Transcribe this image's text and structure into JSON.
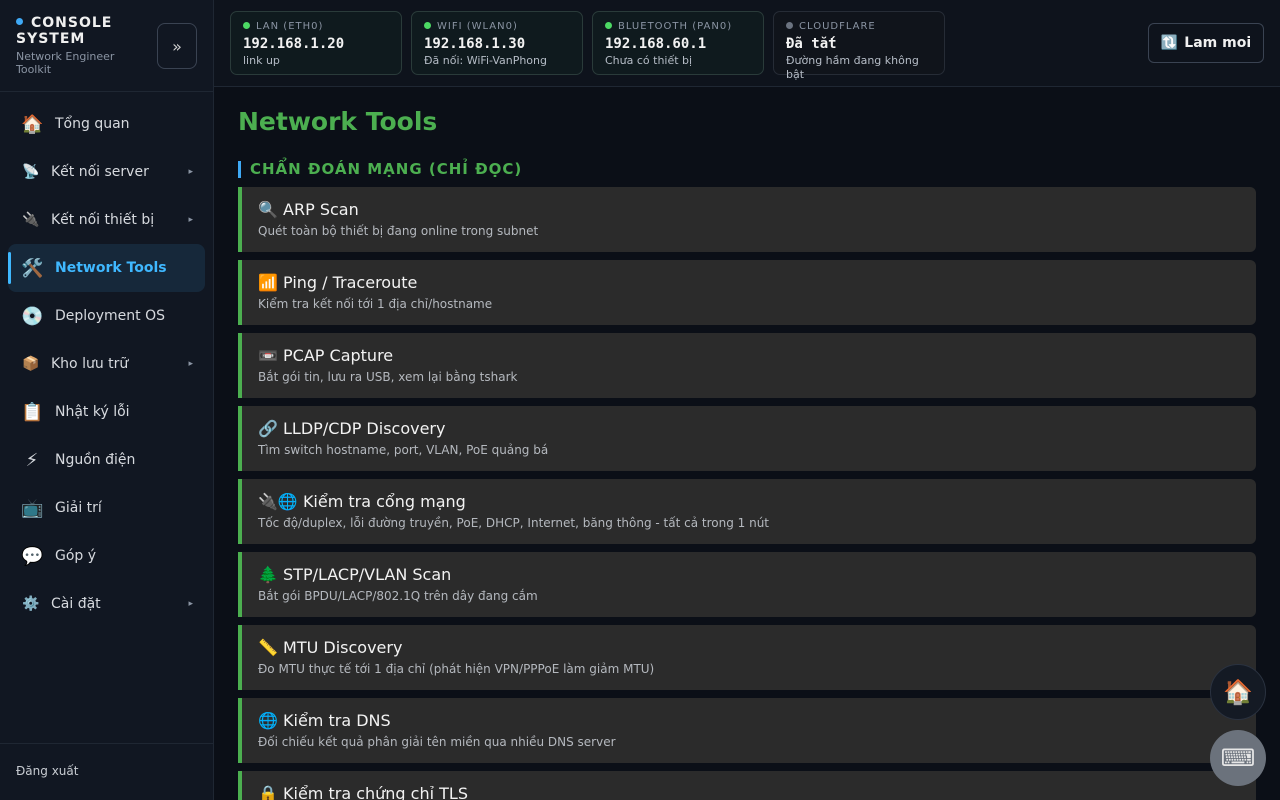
{
  "brand": {
    "title": "CONSOLE SYSTEM",
    "subtitle": "Network Engineer Toolkit",
    "collapse_label": "»"
  },
  "sidebar": {
    "items": [
      {
        "icon": "🏠",
        "label": "Tổng quan",
        "has_submenu": false
      },
      {
        "icon": "📡",
        "label": "Kết nối server",
        "has_submenu": true
      },
      {
        "icon": "🔌",
        "label": "Kết nối thiết bị",
        "has_submenu": true
      },
      {
        "icon": "🛠️",
        "label": "Network Tools",
        "has_submenu": false,
        "active": true
      },
      {
        "icon": "💿",
        "label": "Deployment OS",
        "has_submenu": false
      },
      {
        "icon": "📦",
        "label": "Kho lưu trữ",
        "has_submenu": true
      },
      {
        "icon": "📋",
        "label": "Nhật ký lỗi",
        "has_submenu": false
      },
      {
        "icon": "⚡",
        "label": "Nguồn điện",
        "has_submenu": false
      },
      {
        "icon": "📺",
        "label": "Giải trí",
        "has_submenu": false
      },
      {
        "icon": "💬",
        "label": "Góp ý",
        "has_submenu": false
      },
      {
        "icon": "⚙️",
        "label": "Cài đặt",
        "has_submenu": true
      }
    ],
    "chevron": "▸",
    "logout_label": "Đăng xuất"
  },
  "status_cards": [
    {
      "label": "LAN (ETH0)",
      "value": "192.168.1.20",
      "sub": "link up",
      "status": "up"
    },
    {
      "label": "WIFI (WLAN0)",
      "value": "192.168.1.30",
      "sub": "Đã nối: WiFi-VanPhong",
      "status": "up"
    },
    {
      "label": "BLUETOOTH (PAN0)",
      "value": "192.168.60.1",
      "sub": "Chưa có thiết bị",
      "status": "up"
    },
    {
      "label": "CLOUDFLARE",
      "value": "Đã tắt",
      "sub": "Đường hầm đang không bật",
      "status": "off"
    }
  ],
  "refresh": {
    "icon": "🔃",
    "label": "Lam moi"
  },
  "main": {
    "title": "Network Tools",
    "section_title": "CHẨN ĐOÁN MẠNG (CHỈ ĐỌC)",
    "tools": [
      {
        "icon": "🔍",
        "title": "ARP Scan",
        "desc": "Quét toàn bộ thiết bị đang online trong subnet"
      },
      {
        "icon": "📶",
        "title": "Ping / Traceroute",
        "desc": "Kiểm tra kết nối tới 1 địa chỉ/hostname"
      },
      {
        "icon": "📼",
        "title": "PCAP Capture",
        "desc": "Bắt gói tin, lưu ra USB, xem lại bằng tshark"
      },
      {
        "icon": "🔗",
        "title": "LLDP/CDP Discovery",
        "desc": "Tìm switch hostname, port, VLAN, PoE quảng bá"
      },
      {
        "icon": "🔌🌐",
        "title": "Kiểm tra cổng mạng",
        "desc": "Tốc độ/duplex, lỗi đường truyền, PoE, DHCP, Internet, băng thông - tất cả trong 1 nút"
      },
      {
        "icon": "🌲",
        "title": "STP/LACP/VLAN Scan",
        "desc": "Bắt gói BPDU/LACP/802.1Q trên dây đang cắm"
      },
      {
        "icon": "📏",
        "title": "MTU Discovery",
        "desc": "Đo MTU thực tế tới 1 địa chỉ (phát hiện VPN/PPPoE làm giảm MTU)"
      },
      {
        "icon": "🌐",
        "title": "Kiểm tra DNS",
        "desc": "Đối chiếu kết quả phân giải tên miền qua nhiều DNS server"
      },
      {
        "icon": "🔒",
        "title": "Kiểm tra chứng chỉ TLS",
        "desc": ""
      }
    ]
  },
  "fabs": {
    "home_icon": "🏠",
    "keyboard_icon": "⌨"
  },
  "colors": {
    "accent_green": "#4caf50",
    "accent_blue": "#3fb8ff",
    "status_up": "#4cd964",
    "status_off": "#6b7380"
  }
}
